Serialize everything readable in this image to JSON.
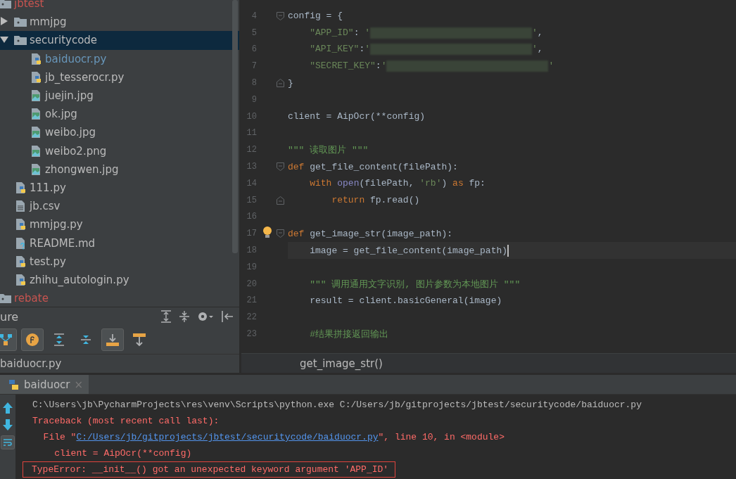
{
  "project_tree": [
    {
      "label": "jbtest",
      "kind": "folder",
      "color": "#c75450",
      "selected": false,
      "children": [
        {
          "label": "mmjpg",
          "kind": "folder",
          "color": "#bbbbbb",
          "selected": false,
          "expanded": false
        },
        {
          "label": "securitycode",
          "kind": "folder",
          "color": "#bbbbbb",
          "selected": true,
          "expanded": true,
          "children": [
            {
              "label": "baiduocr.py",
              "kind": "python",
              "color": "#6897bb",
              "selected": false
            },
            {
              "label": "jb_tesserocr.py",
              "kind": "python",
              "color": "#bbbbbb",
              "selected": false
            },
            {
              "label": "juejin.jpg",
              "kind": "image",
              "color": "#bbbbbb",
              "selected": false
            },
            {
              "label": "ok.jpg",
              "kind": "image",
              "color": "#bbbbbb",
              "selected": false
            },
            {
              "label": "weibo.jpg",
              "kind": "image",
              "color": "#bbbbbb",
              "selected": false
            },
            {
              "label": "weibo2.png",
              "kind": "image",
              "color": "#bbbbbb",
              "selected": false
            },
            {
              "label": "zhongwen.jpg",
              "kind": "image",
              "color": "#bbbbbb",
              "selected": false
            }
          ]
        },
        {
          "label": "111.py",
          "kind": "python",
          "color": "#bbbbbb",
          "selected": false
        },
        {
          "label": "jb.csv",
          "kind": "text",
          "color": "#bbbbbb",
          "selected": false
        },
        {
          "label": "mmjpg.py",
          "kind": "python",
          "color": "#bbbbbb",
          "selected": false
        },
        {
          "label": "README.md",
          "kind": "unknown",
          "color": "#bbbbbb",
          "selected": false
        },
        {
          "label": "test.py",
          "kind": "python",
          "color": "#bbbbbb",
          "selected": false
        },
        {
          "label": "zhihu_autologin.py",
          "kind": "python",
          "color": "#bbbbbb",
          "selected": false
        }
      ]
    },
    {
      "label": "rebate",
      "kind": "folder",
      "color": "#c75450",
      "selected": false
    }
  ],
  "structure": {
    "title": "ure",
    "toggles": [
      {
        "kind": "hierarchy",
        "on": true
      },
      {
        "kind": "fields",
        "on": true
      },
      {
        "kind": "expand",
        "on": false
      },
      {
        "kind": "collapse",
        "on": false
      },
      {
        "kind": "scroll-from",
        "on": true
      },
      {
        "kind": "scroll-to",
        "on": false
      }
    ],
    "file": "baiduocr.py"
  },
  "editor": {
    "lines": [
      {
        "number": "4",
        "fold_start": true,
        "current": false,
        "bulb": false,
        "tokens": [
          {
            "kind": "plain",
            "text": "config = {"
          }
        ]
      },
      {
        "number": "5",
        "current": false,
        "bulb": false,
        "tokens": [
          {
            "kind": "string",
            "text": "    \"APP_ID\""
          },
          {
            "kind": "plain",
            "text": ": "
          },
          {
            "kind": "string",
            "text": "'"
          },
          {
            "kind": "redacted"
          },
          {
            "kind": "string",
            "text": "'"
          },
          {
            "kind": "plain",
            "text": ","
          }
        ]
      },
      {
        "number": "6",
        "current": false,
        "bulb": false,
        "tokens": [
          {
            "kind": "string",
            "text": "    \"API_KEY\""
          },
          {
            "kind": "plain",
            "text": ":"
          },
          {
            "kind": "string",
            "text": "'"
          },
          {
            "kind": "redacted"
          },
          {
            "kind": "string",
            "text": "'"
          },
          {
            "kind": "plain",
            "text": ","
          }
        ]
      },
      {
        "number": "7",
        "current": false,
        "bulb": false,
        "tokens": [
          {
            "kind": "string",
            "text": "    \"SECRET_KEY\""
          },
          {
            "kind": "plain",
            "text": ":"
          },
          {
            "kind": "string",
            "text": "'"
          },
          {
            "kind": "redacted"
          },
          {
            "kind": "string",
            "text": "'"
          }
        ]
      },
      {
        "number": "8",
        "fold_end": true,
        "current": false,
        "bulb": false,
        "tokens": [
          {
            "kind": "plain",
            "text": "}"
          }
        ]
      },
      {
        "number": "9",
        "current": false,
        "bulb": false
      },
      {
        "number": "10",
        "current": false,
        "bulb": false,
        "tokens": [
          {
            "kind": "plain",
            "text": "client = AipOcr(**config)"
          }
        ]
      },
      {
        "number": "11",
        "current": false,
        "bulb": false
      },
      {
        "number": "12",
        "current": false,
        "bulb": false,
        "tokens": [
          {
            "kind": "comment",
            "text": "\"\"\" 读取图片 \"\"\""
          }
        ]
      },
      {
        "number": "13",
        "fold_start": true,
        "current": false,
        "bulb": false,
        "tokens": [
          {
            "kind": "keyword",
            "text": "def"
          },
          {
            "kind": "plain",
            "text": " get_file_content(filePath):"
          }
        ]
      },
      {
        "number": "14",
        "current": false,
        "bulb": false,
        "tokens": [
          {
            "kind": "keyword",
            "text": "    with"
          },
          {
            "kind": "builtin",
            "text": " open"
          },
          {
            "kind": "plain",
            "text": "(filePath, "
          },
          {
            "kind": "string",
            "text": "'rb'"
          },
          {
            "kind": "plain",
            "text": ") "
          },
          {
            "kind": "keyword",
            "text": "as"
          },
          {
            "kind": "plain",
            "text": " fp:"
          }
        ]
      },
      {
        "number": "15",
        "fold_end": true,
        "current": false,
        "bulb": false,
        "tokens": [
          {
            "kind": "keyword",
            "text": "        return"
          },
          {
            "kind": "plain",
            "text": " fp.read()"
          }
        ]
      },
      {
        "number": "16",
        "current": false,
        "bulb": false
      },
      {
        "number": "17",
        "fold_start": true,
        "current": false,
        "bulb": true,
        "tokens": [
          {
            "kind": "keyword",
            "text": "def"
          },
          {
            "kind": "plain",
            "text": " get_image_str(image_path):"
          }
        ]
      },
      {
        "number": "18",
        "current": true,
        "bulb": false,
        "tokens": [
          {
            "kind": "plain",
            "text": "    image = get_file_content(image_path)"
          }
        ]
      },
      {
        "number": "19",
        "current": false,
        "bulb": false
      },
      {
        "number": "20",
        "current": false,
        "bulb": false,
        "tokens": [
          {
            "kind": "comment",
            "text": "    \"\"\" 调用通用文字识别, 图片参数为本地图片 \"\"\""
          }
        ]
      },
      {
        "number": "21",
        "current": false,
        "bulb": false,
        "tokens": [
          {
            "kind": "plain",
            "text": "    result = client.basicGeneral(image)"
          }
        ]
      },
      {
        "number": "22",
        "current": false,
        "bulb": false
      },
      {
        "number": "23",
        "current": false,
        "bulb": false,
        "tokens": [
          {
            "kind": "comment",
            "text": "    #结果拼接返回输出"
          }
        ]
      }
    ],
    "breadcrumb": "get_image_str()"
  },
  "run": {
    "tabs": [
      {
        "label": "baiduocr",
        "selected": true,
        "close": "×"
      }
    ],
    "lines": [
      {
        "boxed": false,
        "parts": [
          {
            "kind": "normal",
            "text": "C:\\Users\\jb\\PycharmProjects\\res\\venv\\Scripts\\python.exe C:/Users/jb/gitprojects/jbtest/securitycode/baiduocr.py"
          }
        ]
      },
      {
        "boxed": false,
        "parts": [
          {
            "kind": "error",
            "text": "Traceback (most recent call last):"
          }
        ]
      },
      {
        "boxed": false,
        "parts": [
          {
            "kind": "error",
            "text": "  File \""
          },
          {
            "kind": "link",
            "text": "C:/Users/jb/gitprojects/jbtest/securitycode/baiduocr.py"
          },
          {
            "kind": "error",
            "text": "\", line 10, in <module>"
          }
        ]
      },
      {
        "boxed": false,
        "parts": [
          {
            "kind": "error",
            "text": "    client = AipOcr(**config)"
          }
        ]
      },
      {
        "boxed": true,
        "parts": [
          {
            "kind": "error",
            "text": "TypeError: __init__() got an unexpected keyword argument 'APP_ID'"
          }
        ]
      }
    ]
  }
}
